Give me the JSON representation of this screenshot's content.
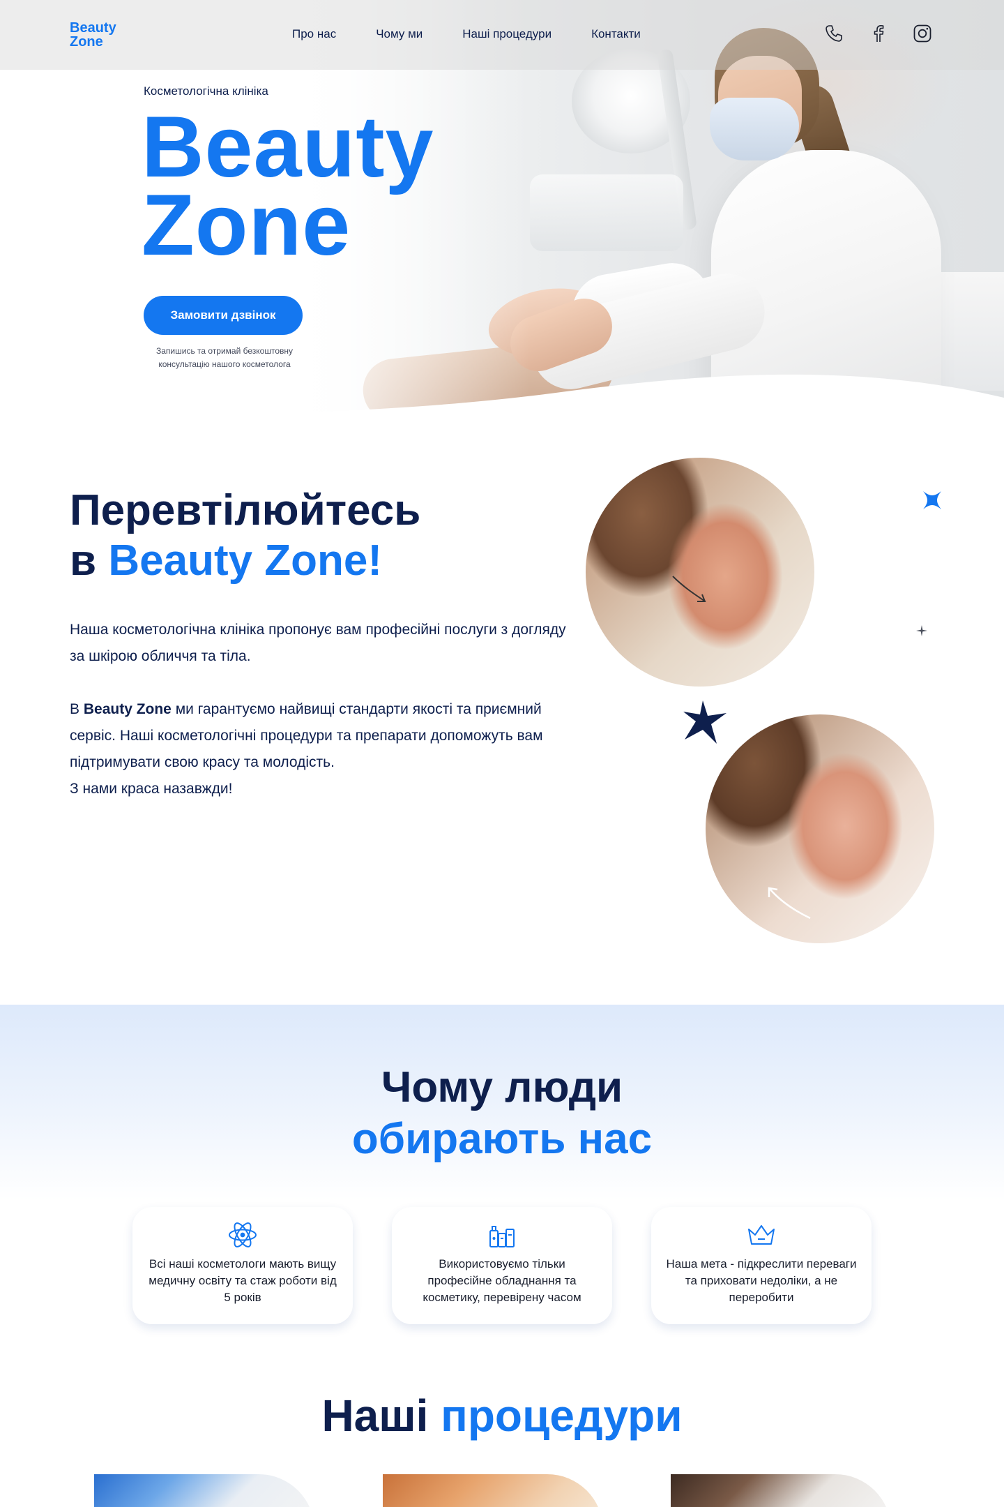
{
  "header": {
    "logo_line1": "Beauty",
    "logo_line2": "Zone",
    "nav": [
      "Про нас",
      "Чому ми",
      "Наші процедури",
      "Контакти"
    ],
    "social_icons": [
      "phone-icon",
      "facebook-icon",
      "instagram-icon"
    ]
  },
  "hero": {
    "kicker": "Косметологічна клініка",
    "title_line1": "Beauty",
    "title_line2": "Zone",
    "cta_label": "Замовити дзвінок",
    "cta_note": "Запишись та отримай безкоштовну консультацію нашого косметолога"
  },
  "about": {
    "title_line1": "Перевтілюйтесь",
    "title_prefix": "в ",
    "title_accent": "Beauty Zone!",
    "p1": "Наша косметологічна клініка пропонує вам професійні послуги з догляду за шкірою обличчя та тіла.",
    "p2_prefix": "В ",
    "p2_bold": "Beauty Zone",
    "p2_rest": " ми гарантуємо найвищі стандарти якості та приємний сервіс. Наші косметологічні процедури та препарати допоможуть вам підтримувати свою красу та молодість.",
    "p2_last": "З нами краса назавжди!"
  },
  "why": {
    "title_line1": "Чому люди",
    "title_line2": "обирають нас",
    "cards": [
      {
        "icon": "atom-icon",
        "text": "Всі наші косметологи мають вищу медичну освіту та стаж роботи від 5 років"
      },
      {
        "icon": "cosmetics-icon",
        "text": "Використовуємо тільки професійне обладнання та косметику, перевірену часом"
      },
      {
        "icon": "crown-icon",
        "text": "Наша мета - підкреслити переваги та приховати недоліки, а не переробити"
      }
    ]
  },
  "procedures": {
    "title_main": "Наші ",
    "title_accent": "процедури"
  },
  "colors": {
    "accent": "#1477f0",
    "navy": "#0e1f4d",
    "topbar": "rgba(214,214,214,0.45)"
  }
}
